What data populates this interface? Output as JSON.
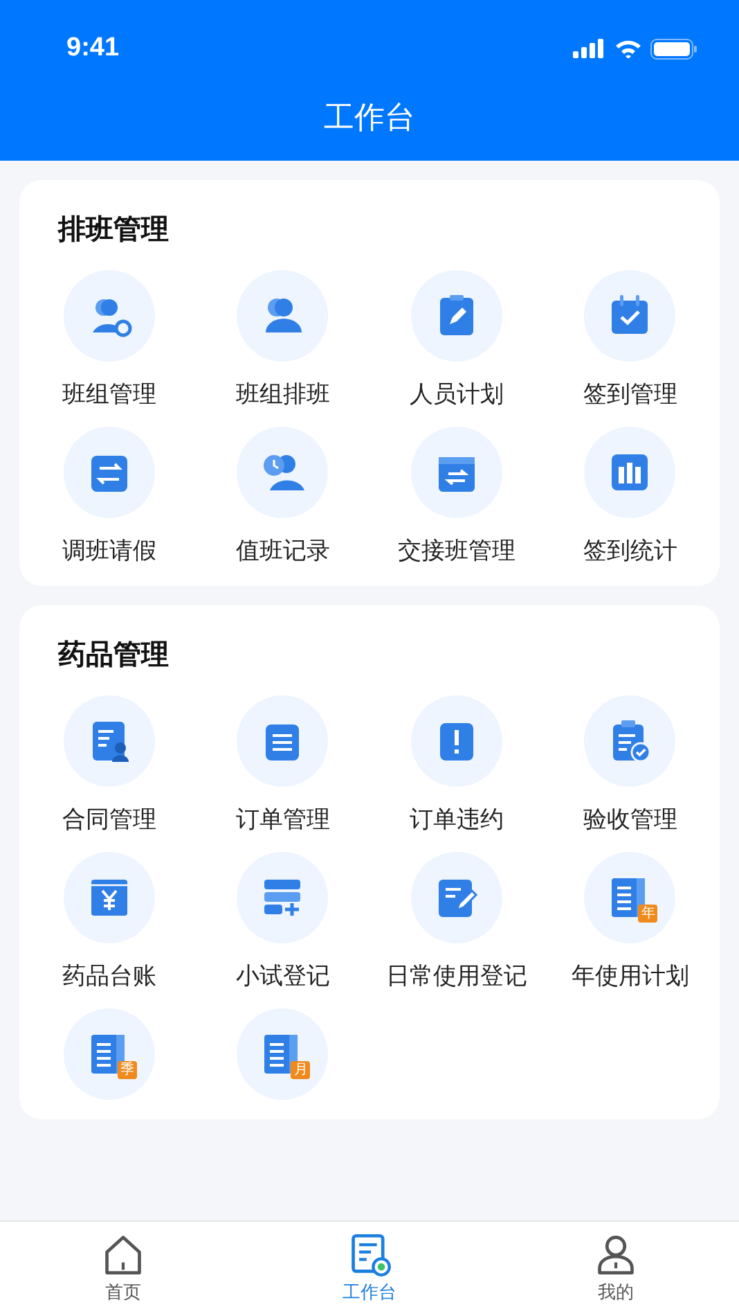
{
  "status_bar": {
    "time": "9:41"
  },
  "nav_bar": {
    "title": "工作台"
  },
  "sections": [
    {
      "title": "排班管理",
      "items": [
        {
          "kind": "teamgear",
          "label": "班组管理"
        },
        {
          "kind": "team",
          "label": "班组排班"
        },
        {
          "kind": "notepad",
          "label": "人员计划"
        },
        {
          "kind": "checkin",
          "label": "签到管理"
        },
        {
          "kind": "swap",
          "label": "调班请假"
        },
        {
          "kind": "duty",
          "label": "值班记录"
        },
        {
          "kind": "handover",
          "label": "交接班管理"
        },
        {
          "kind": "stats",
          "label": "签到统计"
        }
      ]
    },
    {
      "title": "药品管理",
      "items": [
        {
          "kind": "contract",
          "label": "合同管理"
        },
        {
          "kind": "order",
          "label": "订单管理"
        },
        {
          "kind": "alert",
          "label": "订单违约"
        },
        {
          "kind": "inspect",
          "label": "验收管理"
        },
        {
          "kind": "ledger",
          "label": "药品台账"
        },
        {
          "kind": "trial",
          "label": "小试登记"
        },
        {
          "kind": "daily",
          "label": "日常使用登记"
        },
        {
          "kind": "plan",
          "badge": "年",
          "label": "年使用计划"
        },
        {
          "kind": "plan",
          "badge": "季"
        },
        {
          "kind": "plan",
          "badge": "月"
        }
      ]
    }
  ],
  "tab_bar": [
    {
      "kind": "home",
      "label": "首页",
      "selected": false
    },
    {
      "kind": "work",
      "label": "工作台",
      "selected": true
    },
    {
      "kind": "me",
      "label": "我的",
      "selected": false
    }
  ]
}
